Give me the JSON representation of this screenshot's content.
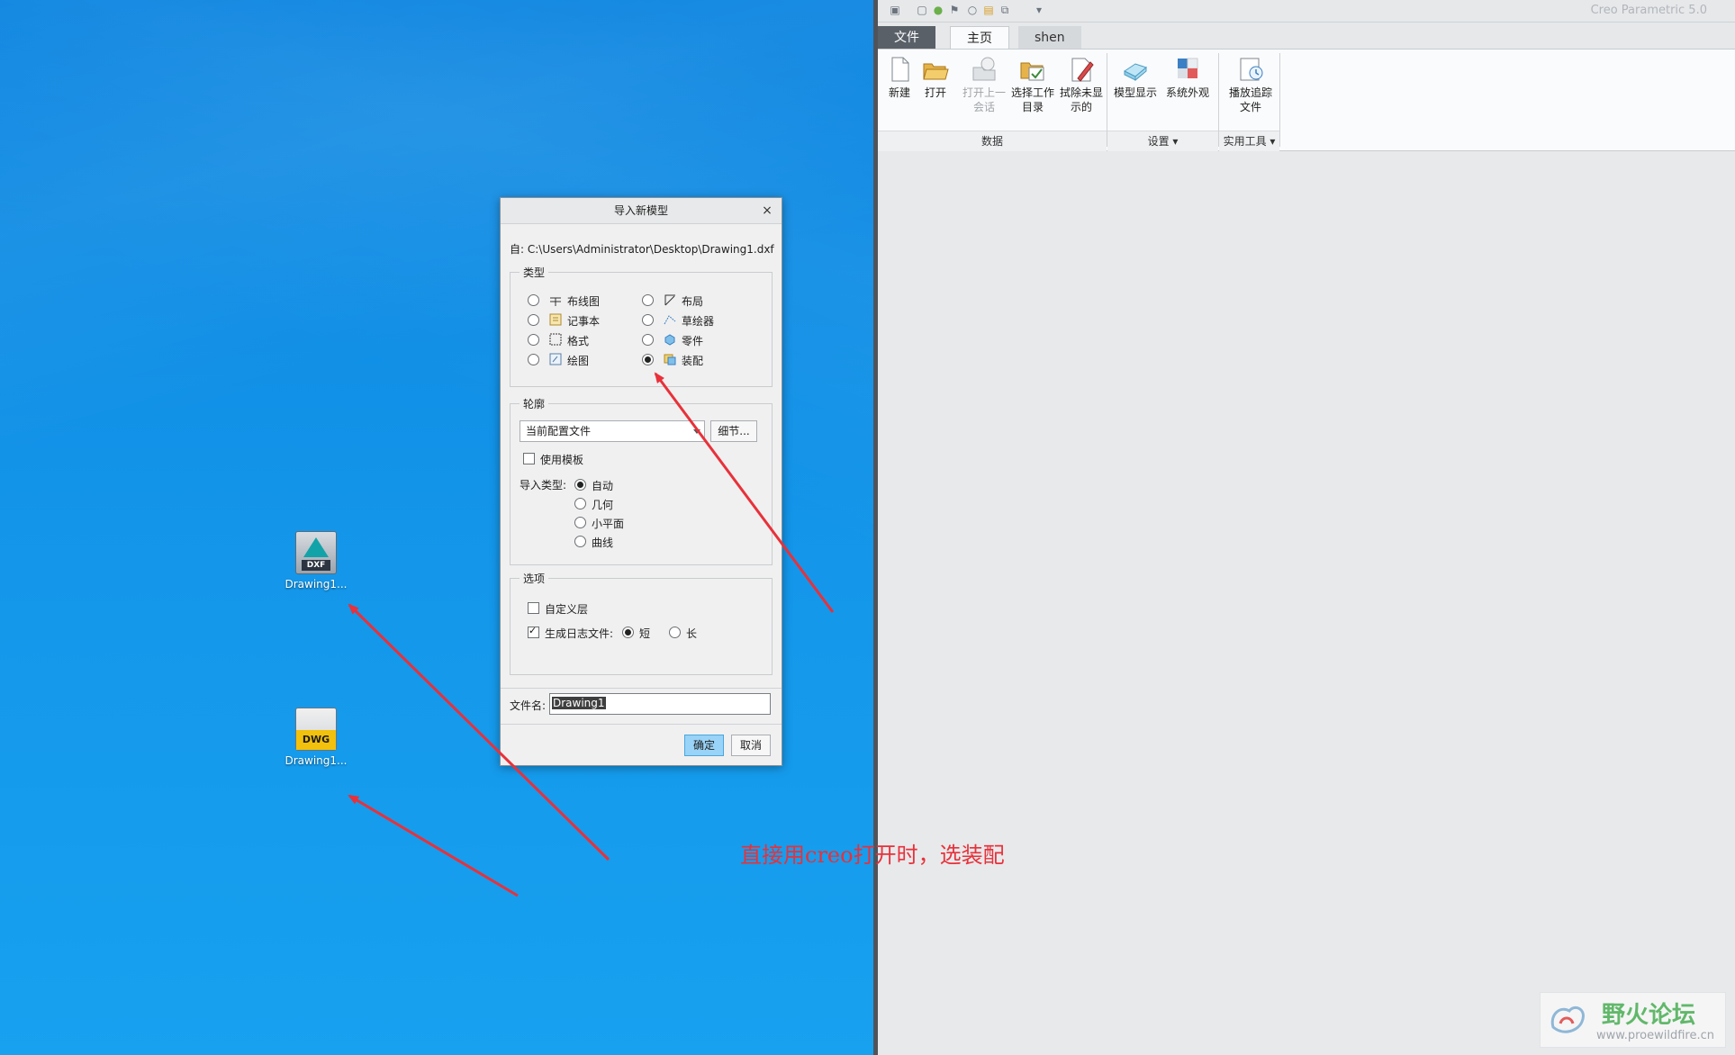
{
  "desktop": {
    "icons": [
      {
        "label": "Drawing1...",
        "type_tag": "DXF"
      },
      {
        "label": "Drawing1...",
        "type_tag": "DWG"
      }
    ]
  },
  "creo": {
    "app_title": "Creo Parametric 5.0",
    "tabs": [
      "文件",
      "主页",
      "shen"
    ],
    "ribbon": {
      "buttons": [
        {
          "label": "新建"
        },
        {
          "label": "打开"
        },
        {
          "label_line1": "打开上一",
          "label_line2": "会话"
        },
        {
          "label_line1": "选择工作",
          "label_line2": "目录"
        },
        {
          "label_line1": "拭除未显",
          "label_line2": "示的"
        },
        {
          "label": "模型显示"
        },
        {
          "label": "系统外观"
        },
        {
          "label_line1": "播放追踪",
          "label_line2": "文件"
        }
      ],
      "groups": [
        "数据",
        "设置",
        "实用工具"
      ]
    }
  },
  "dialog": {
    "title": "导入新模型",
    "from_label": "自:",
    "from_path": "C:\\Users\\Administrator\\Desktop\\Drawing1.dxf",
    "type_section": {
      "legend": "类型",
      "options": [
        {
          "label": "布线图",
          "icon": "wiring-diagram-icon"
        },
        {
          "label": "布局",
          "icon": "layout-icon"
        },
        {
          "label": "记事本",
          "icon": "notebook-icon"
        },
        {
          "label": "草绘器",
          "icon": "sketcher-icon"
        },
        {
          "label": "格式",
          "icon": "format-icon"
        },
        {
          "label": "零件",
          "icon": "part-icon"
        },
        {
          "label": "绘图",
          "icon": "drawing-icon"
        },
        {
          "label": "装配",
          "icon": "assembly-icon"
        }
      ],
      "selected": "装配"
    },
    "profile_section": {
      "legend": "轮廓",
      "select_value": "当前配置文件",
      "details_button": "细节...",
      "use_template_label": "使用模板",
      "use_template_checked": false,
      "import_type_label": "导入类型:",
      "import_types": [
        "自动",
        "几何",
        "小平面",
        "曲线"
      ],
      "import_type_selected": "自动"
    },
    "options_section": {
      "legend": "选项",
      "custom_layer_label": "自定义层",
      "custom_layer_checked": false,
      "log_file_label": "生成日志文件:",
      "log_file_checked": true,
      "log_short_label": "短",
      "log_long_label": "长",
      "log_selected": "短"
    },
    "filename_label": "文件名:",
    "filename_value": "Drawing1",
    "ok_label": "确定",
    "cancel_label": "取消"
  },
  "annotation": {
    "text": "直接用creo打开时，选装配",
    "color": "#e8313a"
  },
  "watermark": {
    "title": "野火论坛",
    "url": "www.proewildfire.cn"
  }
}
